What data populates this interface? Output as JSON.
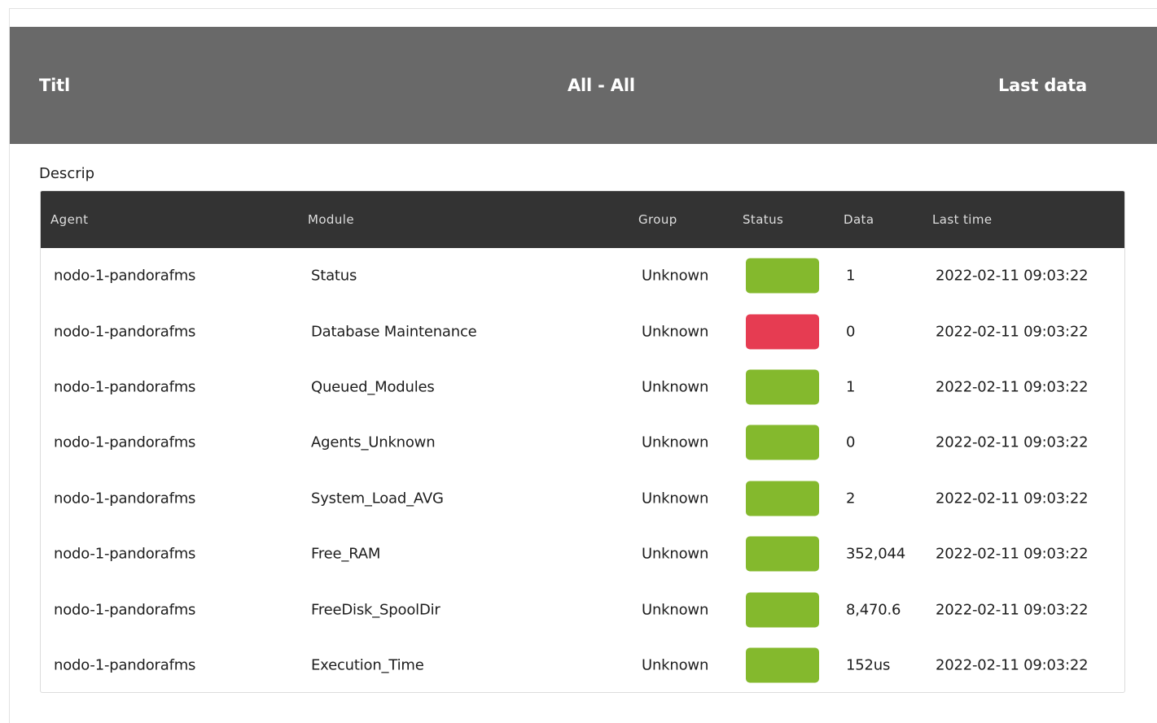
{
  "header": {
    "title": "Titl",
    "center": "All - All",
    "right": "Last data"
  },
  "description": "Descrip",
  "table": {
    "columns": {
      "agent": "Agent",
      "module": "Module",
      "group": "Group",
      "status": "Status",
      "data": "Data",
      "last_time": "Last time"
    },
    "rows": [
      {
        "agent": "nodo-1-pandorafms",
        "module": "Status",
        "group": "Unknown",
        "status": "ok",
        "status_color": "#84b92d",
        "data": "1",
        "last_time": "2022-02-11 09:03:22"
      },
      {
        "agent": "nodo-1-pandorafms",
        "module": "Database Maintenance",
        "group": "Unknown",
        "status": "critical",
        "status_color": "#e63c52",
        "data": "0",
        "last_time": "2022-02-11 09:03:22"
      },
      {
        "agent": "nodo-1-pandorafms",
        "module": "Queued_Modules",
        "group": "Unknown",
        "status": "ok",
        "status_color": "#84b92d",
        "data": "1",
        "last_time": "2022-02-11 09:03:22"
      },
      {
        "agent": "nodo-1-pandorafms",
        "module": "Agents_Unknown",
        "group": "Unknown",
        "status": "ok",
        "status_color": "#84b92d",
        "data": "0",
        "last_time": "2022-02-11 09:03:22"
      },
      {
        "agent": "nodo-1-pandorafms",
        "module": "System_Load_AVG",
        "group": "Unknown",
        "status": "ok",
        "status_color": "#84b92d",
        "data": "2",
        "last_time": "2022-02-11 09:03:22"
      },
      {
        "agent": "nodo-1-pandorafms",
        "module": "Free_RAM",
        "group": "Unknown",
        "status": "ok",
        "status_color": "#84b92d",
        "data": "352,044",
        "last_time": "2022-02-11 09:03:22"
      },
      {
        "agent": "nodo-1-pandorafms",
        "module": "FreeDisk_SpoolDir",
        "group": "Unknown",
        "status": "ok",
        "status_color": "#84b92d",
        "data": "8,470.6",
        "last_time": "2022-02-11 09:03:22"
      },
      {
        "agent": "nodo-1-pandorafms",
        "module": "Execution_Time",
        "group": "Unknown",
        "status": "ok",
        "status_color": "#84b92d",
        "data": "152us",
        "last_time": "2022-02-11 09:03:22"
      }
    ]
  },
  "colors": {
    "header_bg": "#696969",
    "table_header_bg": "#333333",
    "status_ok": "#84b92d",
    "status_critical": "#e63c52"
  }
}
